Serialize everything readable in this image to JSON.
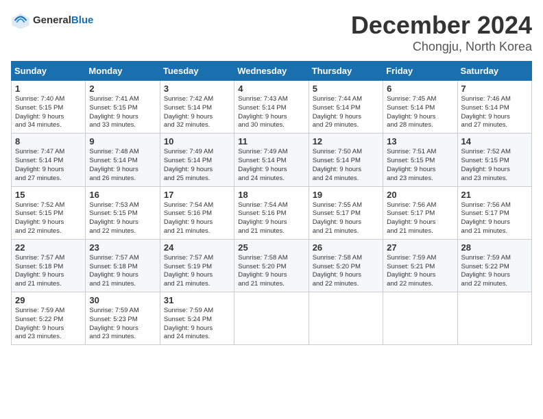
{
  "header": {
    "logo": {
      "text1": "General",
      "text2": "Blue"
    },
    "month": "December 2024",
    "location": "Chongju, North Korea"
  },
  "weekdays": [
    "Sunday",
    "Monday",
    "Tuesday",
    "Wednesday",
    "Thursday",
    "Friday",
    "Saturday"
  ],
  "weeks": [
    [
      {
        "day": "1",
        "lines": [
          "Sunrise: 7:40 AM",
          "Sunset: 5:15 PM",
          "Daylight: 9 hours",
          "and 34 minutes."
        ]
      },
      {
        "day": "2",
        "lines": [
          "Sunrise: 7:41 AM",
          "Sunset: 5:15 PM",
          "Daylight: 9 hours",
          "and 33 minutes."
        ]
      },
      {
        "day": "3",
        "lines": [
          "Sunrise: 7:42 AM",
          "Sunset: 5:14 PM",
          "Daylight: 9 hours",
          "and 32 minutes."
        ]
      },
      {
        "day": "4",
        "lines": [
          "Sunrise: 7:43 AM",
          "Sunset: 5:14 PM",
          "Daylight: 9 hours",
          "and 30 minutes."
        ]
      },
      {
        "day": "5",
        "lines": [
          "Sunrise: 7:44 AM",
          "Sunset: 5:14 PM",
          "Daylight: 9 hours",
          "and 29 minutes."
        ]
      },
      {
        "day": "6",
        "lines": [
          "Sunrise: 7:45 AM",
          "Sunset: 5:14 PM",
          "Daylight: 9 hours",
          "and 28 minutes."
        ]
      },
      {
        "day": "7",
        "lines": [
          "Sunrise: 7:46 AM",
          "Sunset: 5:14 PM",
          "Daylight: 9 hours",
          "and 27 minutes."
        ]
      }
    ],
    [
      {
        "day": "8",
        "lines": [
          "Sunrise: 7:47 AM",
          "Sunset: 5:14 PM",
          "Daylight: 9 hours",
          "and 27 minutes."
        ]
      },
      {
        "day": "9",
        "lines": [
          "Sunrise: 7:48 AM",
          "Sunset: 5:14 PM",
          "Daylight: 9 hours",
          "and 26 minutes."
        ]
      },
      {
        "day": "10",
        "lines": [
          "Sunrise: 7:49 AM",
          "Sunset: 5:14 PM",
          "Daylight: 9 hours",
          "and 25 minutes."
        ]
      },
      {
        "day": "11",
        "lines": [
          "Sunrise: 7:49 AM",
          "Sunset: 5:14 PM",
          "Daylight: 9 hours",
          "and 24 minutes."
        ]
      },
      {
        "day": "12",
        "lines": [
          "Sunrise: 7:50 AM",
          "Sunset: 5:14 PM",
          "Daylight: 9 hours",
          "and 24 minutes."
        ]
      },
      {
        "day": "13",
        "lines": [
          "Sunrise: 7:51 AM",
          "Sunset: 5:15 PM",
          "Daylight: 9 hours",
          "and 23 minutes."
        ]
      },
      {
        "day": "14",
        "lines": [
          "Sunrise: 7:52 AM",
          "Sunset: 5:15 PM",
          "Daylight: 9 hours",
          "and 23 minutes."
        ]
      }
    ],
    [
      {
        "day": "15",
        "lines": [
          "Sunrise: 7:52 AM",
          "Sunset: 5:15 PM",
          "Daylight: 9 hours",
          "and 22 minutes."
        ]
      },
      {
        "day": "16",
        "lines": [
          "Sunrise: 7:53 AM",
          "Sunset: 5:15 PM",
          "Daylight: 9 hours",
          "and 22 minutes."
        ]
      },
      {
        "day": "17",
        "lines": [
          "Sunrise: 7:54 AM",
          "Sunset: 5:16 PM",
          "Daylight: 9 hours",
          "and 21 minutes."
        ]
      },
      {
        "day": "18",
        "lines": [
          "Sunrise: 7:54 AM",
          "Sunset: 5:16 PM",
          "Daylight: 9 hours",
          "and 21 minutes."
        ]
      },
      {
        "day": "19",
        "lines": [
          "Sunrise: 7:55 AM",
          "Sunset: 5:17 PM",
          "Daylight: 9 hours",
          "and 21 minutes."
        ]
      },
      {
        "day": "20",
        "lines": [
          "Sunrise: 7:56 AM",
          "Sunset: 5:17 PM",
          "Daylight: 9 hours",
          "and 21 minutes."
        ]
      },
      {
        "day": "21",
        "lines": [
          "Sunrise: 7:56 AM",
          "Sunset: 5:17 PM",
          "Daylight: 9 hours",
          "and 21 minutes."
        ]
      }
    ],
    [
      {
        "day": "22",
        "lines": [
          "Sunrise: 7:57 AM",
          "Sunset: 5:18 PM",
          "Daylight: 9 hours",
          "and 21 minutes."
        ]
      },
      {
        "day": "23",
        "lines": [
          "Sunrise: 7:57 AM",
          "Sunset: 5:18 PM",
          "Daylight: 9 hours",
          "and 21 minutes."
        ]
      },
      {
        "day": "24",
        "lines": [
          "Sunrise: 7:57 AM",
          "Sunset: 5:19 PM",
          "Daylight: 9 hours",
          "and 21 minutes."
        ]
      },
      {
        "day": "25",
        "lines": [
          "Sunrise: 7:58 AM",
          "Sunset: 5:20 PM",
          "Daylight: 9 hours",
          "and 21 minutes."
        ]
      },
      {
        "day": "26",
        "lines": [
          "Sunrise: 7:58 AM",
          "Sunset: 5:20 PM",
          "Daylight: 9 hours",
          "and 22 minutes."
        ]
      },
      {
        "day": "27",
        "lines": [
          "Sunrise: 7:59 AM",
          "Sunset: 5:21 PM",
          "Daylight: 9 hours",
          "and 22 minutes."
        ]
      },
      {
        "day": "28",
        "lines": [
          "Sunrise: 7:59 AM",
          "Sunset: 5:22 PM",
          "Daylight: 9 hours",
          "and 22 minutes."
        ]
      }
    ],
    [
      {
        "day": "29",
        "lines": [
          "Sunrise: 7:59 AM",
          "Sunset: 5:22 PM",
          "Daylight: 9 hours",
          "and 23 minutes."
        ]
      },
      {
        "day": "30",
        "lines": [
          "Sunrise: 7:59 AM",
          "Sunset: 5:23 PM",
          "Daylight: 9 hours",
          "and 23 minutes."
        ]
      },
      {
        "day": "31",
        "lines": [
          "Sunrise: 7:59 AM",
          "Sunset: 5:24 PM",
          "Daylight: 9 hours",
          "and 24 minutes."
        ]
      },
      null,
      null,
      null,
      null
    ]
  ]
}
